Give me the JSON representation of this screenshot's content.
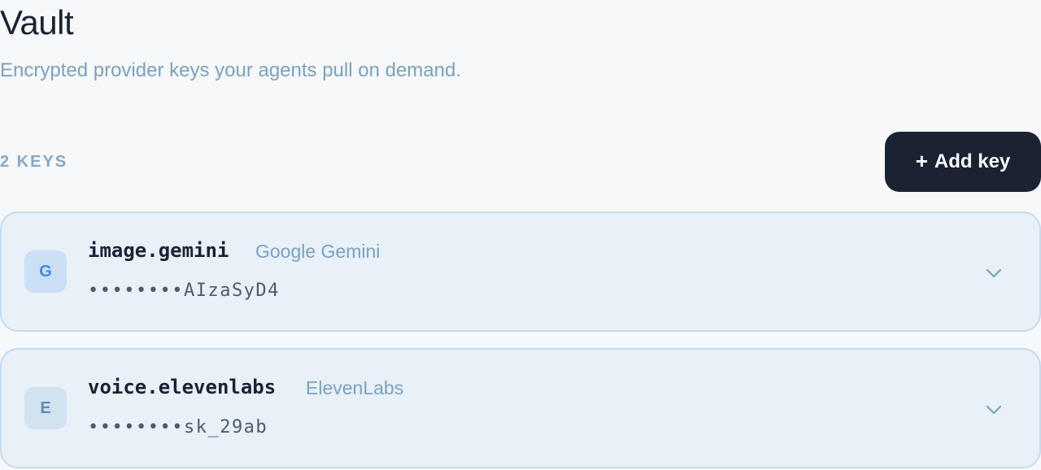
{
  "page": {
    "title": "Vault",
    "subtitle": "Encrypted provider keys your agents pull on demand."
  },
  "toolbar": {
    "count_label": "2 KEYS",
    "add_button_plus": "+",
    "add_button_label": "Add key"
  },
  "keys": [
    {
      "badge": "G",
      "name": "image.gemini",
      "provider": "Google Gemini",
      "masked_value": "••••••••AIzaSyD4",
      "badge_icon": "google-badge-icon",
      "badge_color": "#4a86e0"
    },
    {
      "badge": "E",
      "name": "voice.elevenlabs",
      "provider": "ElevenLabs",
      "masked_value": "••••••••sk_29ab",
      "badge_icon": "elevenlabs-badge-icon",
      "badge_color": "#5f8db3"
    }
  ],
  "colors": {
    "background": "#f6f8fa",
    "primary_dark": "#1b2333",
    "muted_blue": "#7ba2c2",
    "card_bg": "#e8f0f8",
    "card_border": "#c6dcee"
  }
}
